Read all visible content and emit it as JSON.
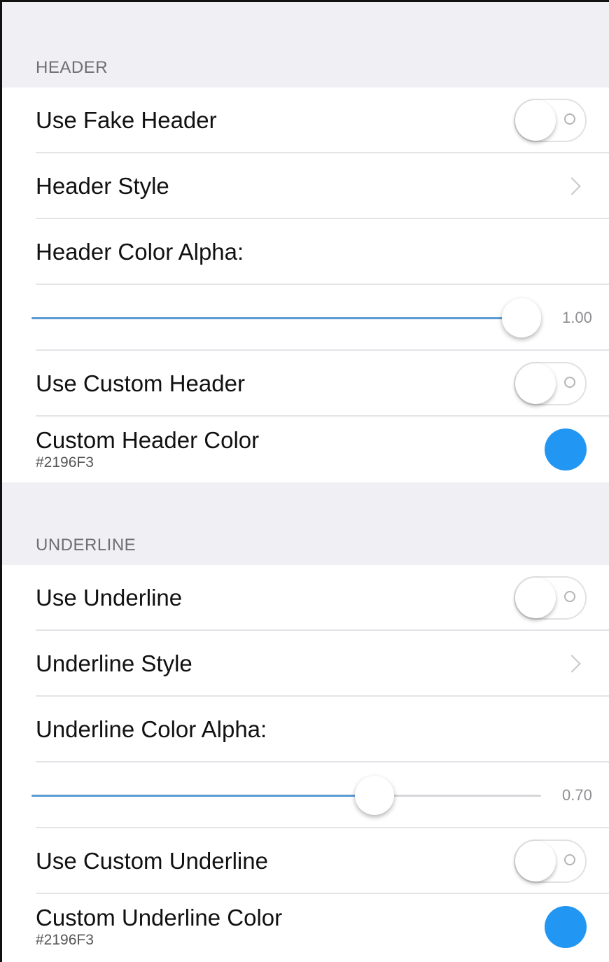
{
  "accent_color": "#2196F3",
  "sections": [
    {
      "title": "HEADER",
      "use_fake": {
        "label": "Use Fake Header",
        "on": false
      },
      "style": {
        "label": "Header Style"
      },
      "alpha": {
        "label": "Header Color Alpha:",
        "value": 1.0,
        "value_text": "1.00"
      },
      "use_custom": {
        "label": "Use Custom Header",
        "on": false
      },
      "custom_color": {
        "label": "Custom Header Color",
        "hex": "#2196F3"
      }
    },
    {
      "title": "UNDERLINE",
      "use_fake": {
        "label": "Use Underline",
        "on": false
      },
      "style": {
        "label": "Underline Style"
      },
      "alpha": {
        "label": "Underline Color Alpha:",
        "value": 0.7,
        "value_text": "0.70"
      },
      "use_custom": {
        "label": "Use Custom Underline",
        "on": false
      },
      "custom_color": {
        "label": "Custom Underline Color",
        "hex": "#2196F3"
      }
    }
  ]
}
